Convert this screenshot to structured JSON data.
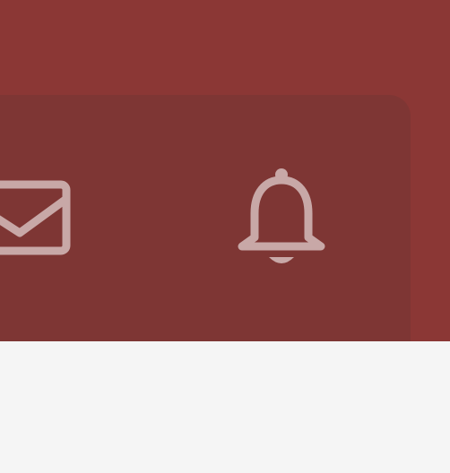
{
  "header": {
    "background_color": "#8b3735",
    "panel_color": "#7e3634",
    "icon_color": "#c8a8a7"
  },
  "toolbar": {
    "icons": [
      {
        "name": "mail-icon"
      },
      {
        "name": "bell-icon"
      }
    ]
  },
  "content": {
    "background_color": "#f5f5f5"
  }
}
